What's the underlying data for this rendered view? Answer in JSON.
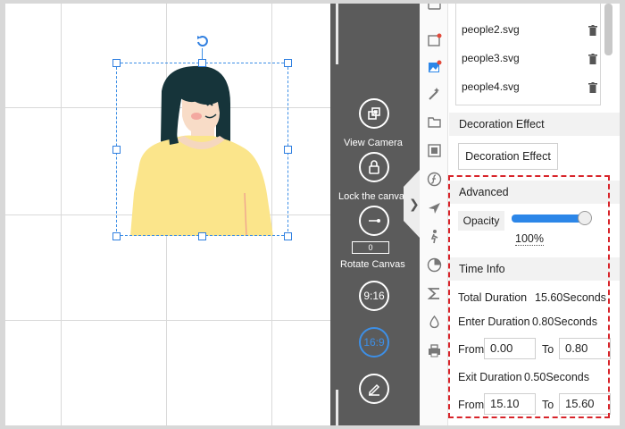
{
  "toolbar": {
    "view_camera": "View Camera",
    "lock_canvas": "Lock the canva",
    "rotate_canvas": "Rotate Canvas",
    "rotate_value": "0",
    "ratio_916": "9:16",
    "ratio_169": "16:9"
  },
  "files": [
    {
      "name": "people2.svg"
    },
    {
      "name": "people3.svg"
    },
    {
      "name": "people4.svg"
    }
  ],
  "decoration": {
    "header": "Decoration Effect",
    "button": "Decoration Effect"
  },
  "advanced": {
    "header": "Advanced",
    "opacity_label": "Opacity",
    "opacity_value": "100%",
    "opacity_level": 1.0
  },
  "time_info": {
    "header": "Time Info",
    "total_label": "Total Duration",
    "total_value": "15.60Seconds",
    "enter_label": "Enter Duration",
    "enter_value": "0.80Seconds",
    "from_label": "From",
    "to_label": "To",
    "enter_from": "0.00",
    "enter_to": "0.80",
    "exit_label": "Exit Duration",
    "exit_value": "0.50Seconds",
    "exit_from": "15.10",
    "exit_to": "15.60"
  },
  "colors": {
    "accent": "#2c86e8",
    "highlight": "#d8242a",
    "toolbar": "#5b5b5b"
  }
}
